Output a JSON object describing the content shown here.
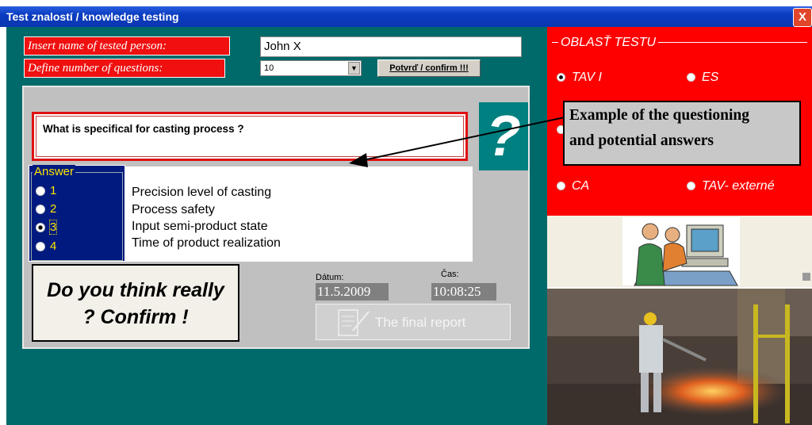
{
  "window": {
    "title": "Test znalostí / knowledge testing",
    "close": "X"
  },
  "form": {
    "name_label": "Insert name of tested person:",
    "name_value": "John X",
    "count_label": "Define number of questions:",
    "count_value": "10",
    "confirm_label": "Potvrď / confirm !!!"
  },
  "question": {
    "text": "What is specifical for casting process ?",
    "mark": "?"
  },
  "answer": {
    "legend": "Answer",
    "options": [
      "1",
      "2",
      "3",
      "4"
    ],
    "selected_index": 2,
    "texts": [
      "Precision level of casting",
      "Process safety",
      "Input semi-product state",
      "Time of product realization"
    ]
  },
  "confirm_button": {
    "line1": "Do you think really",
    "line2": "? Confirm !"
  },
  "date": {
    "label": "Dátum:",
    "value": "11.5.2009"
  },
  "time": {
    "label": "Čas:",
    "value": "10:08:25"
  },
  "report_button": {
    "label": "The final report"
  },
  "test_area": {
    "legend": "OBLASŤ TESTU",
    "options": [
      {
        "label": "TAV I",
        "selected": true
      },
      {
        "label": "ES",
        "selected": false
      },
      {
        "label": "CA",
        "selected": false
      },
      {
        "label": "TAV- externé",
        "selected": false
      }
    ]
  },
  "annotation": {
    "line1": "Example of the questioning",
    "line2": "and potential answers"
  },
  "colors": {
    "teal": "#006a6a",
    "red": "#ff0000",
    "navy": "#001a80",
    "yellow": "#ffe600",
    "titlebar": "#0a3cc0"
  }
}
